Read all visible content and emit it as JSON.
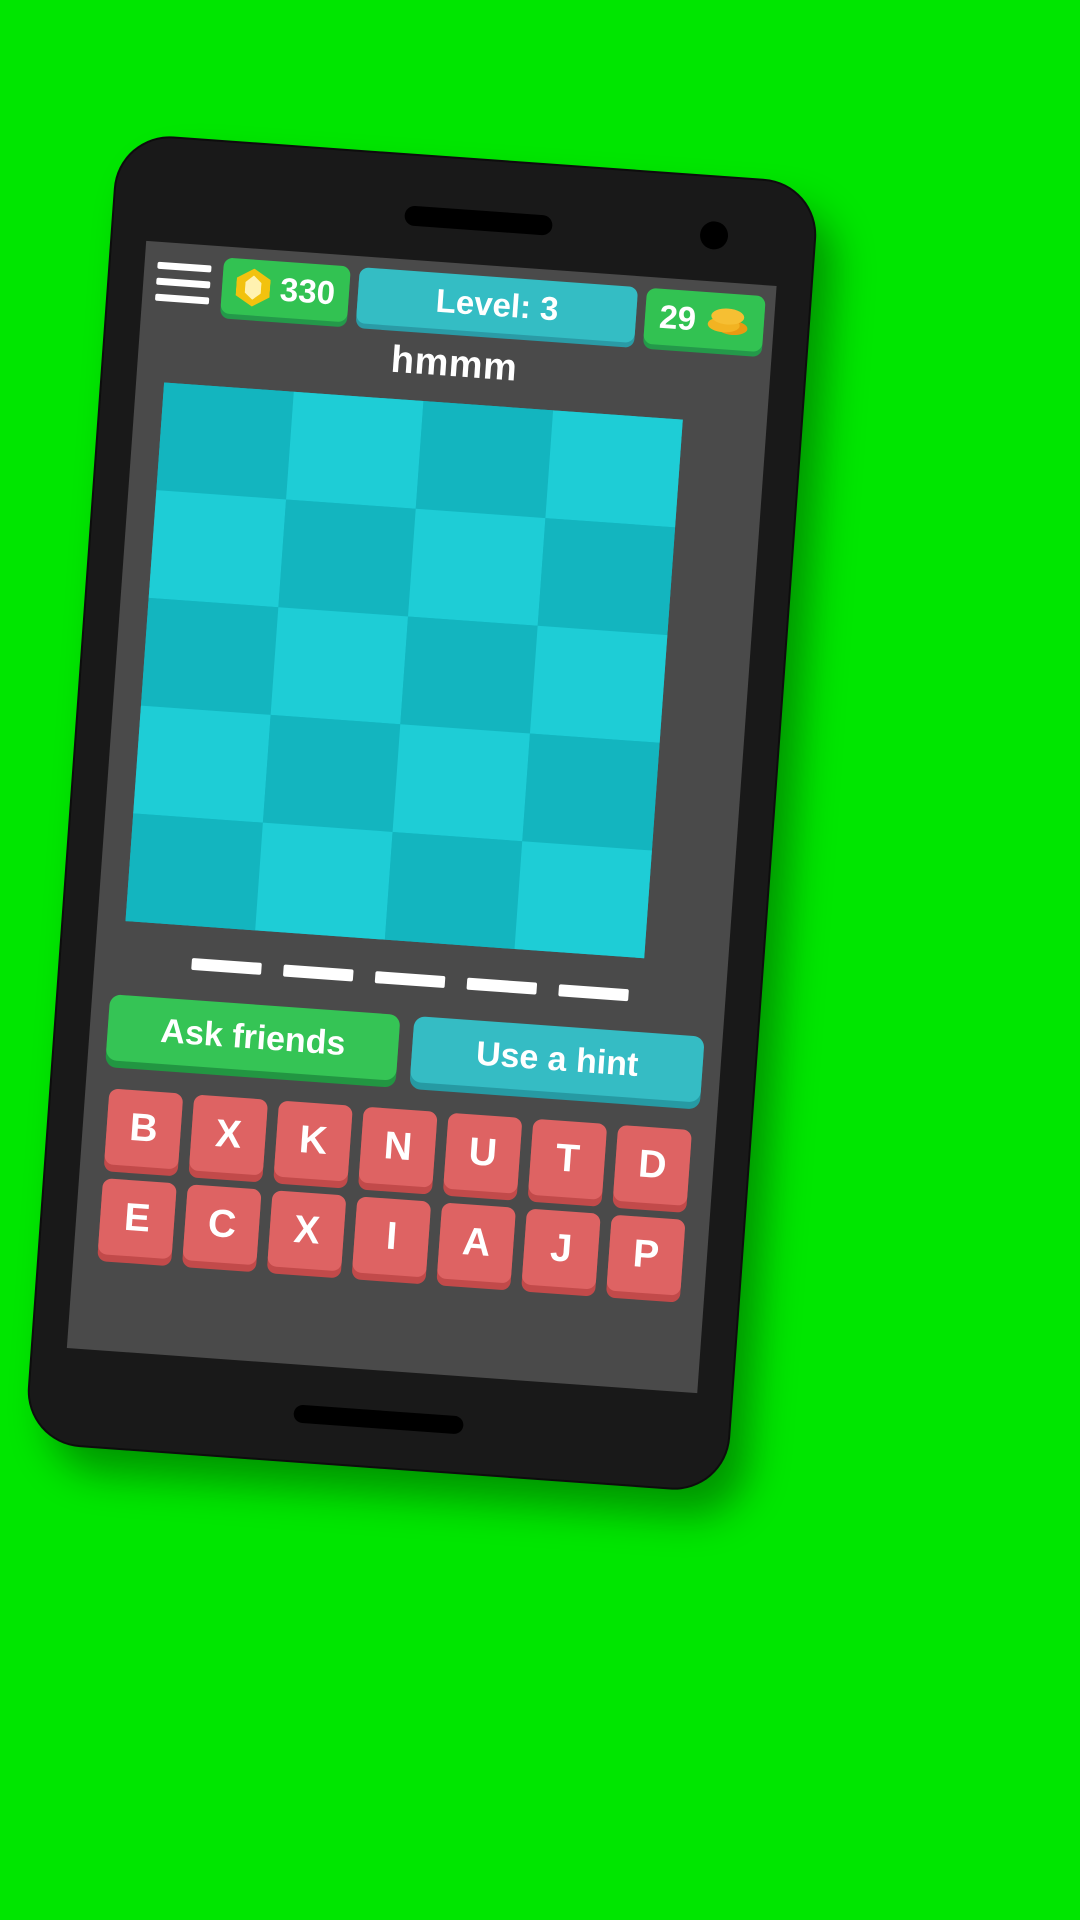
{
  "background_color": "#00e600",
  "device": {
    "body_color": "#191919",
    "screen_bg": "#4a4a4a"
  },
  "header": {
    "menu_icon": "hamburger-menu-icon",
    "gems": {
      "icon": "gem-icon",
      "value": "330",
      "color": "#32c252"
    },
    "level": {
      "label": "Level: 3",
      "color": "#34bdc4"
    },
    "coins": {
      "icon": "coin-stack-icon",
      "value": "29",
      "color": "#32c252"
    }
  },
  "puzzle": {
    "title": "hmmm",
    "grid": {
      "rows": 5,
      "cols": 4,
      "color_light": "#1ecdd6",
      "color_dark": "#13b5bf",
      "tiles": [
        "#13b5bf",
        "#1ecdd6",
        "#13b5bf",
        "#1ecdd6",
        "#1ecdd6",
        "#13b5bf",
        "#1ecdd6",
        "#13b5bf",
        "#13b5bf",
        "#1ecdd6",
        "#13b5bf",
        "#1ecdd6",
        "#1ecdd6",
        "#13b5bf",
        "#1ecdd6",
        "#13b5bf",
        "#13b5bf",
        "#1ecdd6",
        "#13b5bf",
        "#1ecdd6"
      ]
    },
    "answer_slots": 5
  },
  "actions": {
    "ask_friends": "Ask friends",
    "use_hint": "Use a hint"
  },
  "keyboard": {
    "key_color": "#de6363",
    "rows": [
      [
        "B",
        "X",
        "K",
        "N",
        "U",
        "T",
        "D"
      ],
      [
        "E",
        "C",
        "X",
        "I",
        "A",
        "J",
        "P"
      ]
    ]
  }
}
